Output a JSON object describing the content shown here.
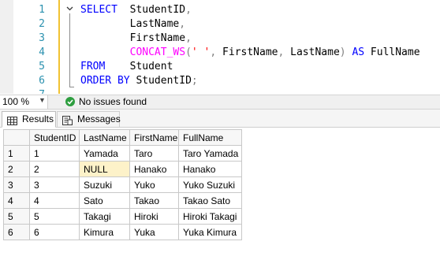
{
  "editor": {
    "lines": [
      {
        "num": "1",
        "tokens": [
          {
            "t": "SELECT",
            "c": "kw"
          },
          {
            "t": "  StudentID",
            "c": "id"
          },
          {
            "t": ",",
            "c": "pun"
          }
        ]
      },
      {
        "num": "2",
        "tokens": [
          {
            "t": "        LastName",
            "c": "id"
          },
          {
            "t": ",",
            "c": "pun"
          }
        ]
      },
      {
        "num": "3",
        "tokens": [
          {
            "t": "        FirstName",
            "c": "id"
          },
          {
            "t": ",",
            "c": "pun"
          }
        ]
      },
      {
        "num": "4",
        "tokens": [
          {
            "t": "        ",
            "c": "id"
          },
          {
            "t": "CONCAT_WS",
            "c": "fn"
          },
          {
            "t": "(",
            "c": "pun"
          },
          {
            "t": "' '",
            "c": "str"
          },
          {
            "t": ", ",
            "c": "pun"
          },
          {
            "t": "FirstName",
            "c": "id"
          },
          {
            "t": ", ",
            "c": "pun"
          },
          {
            "t": "LastName",
            "c": "id"
          },
          {
            "t": ") ",
            "c": "pun"
          },
          {
            "t": "AS",
            "c": "kw"
          },
          {
            "t": " FullName",
            "c": "id"
          }
        ]
      },
      {
        "num": "5",
        "tokens": [
          {
            "t": "FROM",
            "c": "kw"
          },
          {
            "t": "    Student",
            "c": "id"
          }
        ]
      },
      {
        "num": "6",
        "tokens": [
          {
            "t": "ORDER BY",
            "c": "kw"
          },
          {
            "t": " StudentID",
            "c": "id"
          },
          {
            "t": ";",
            "c": "pun"
          }
        ]
      },
      {
        "num": "7",
        "tokens": []
      }
    ]
  },
  "status": {
    "zoom": "100 %",
    "issues": "No issues found"
  },
  "tabs": {
    "results": "Results",
    "messages": "Messages"
  },
  "grid": {
    "columns": [
      "StudentID",
      "LastName",
      "FirstName",
      "FullName"
    ],
    "rows": [
      {
        "num": "1",
        "cells": [
          "1",
          "Yamada",
          "Taro",
          "Taro Yamada"
        ]
      },
      {
        "num": "2",
        "cells": [
          "2",
          "NULL",
          "Hanako",
          "Hanako"
        ]
      },
      {
        "num": "3",
        "cells": [
          "3",
          "Suzuki",
          "Yuko",
          "Yuko Suzuki"
        ]
      },
      {
        "num": "4",
        "cells": [
          "4",
          "Sato",
          "Takao",
          "Takao Sato"
        ]
      },
      {
        "num": "5",
        "cells": [
          "5",
          "Takagi",
          "Hiroki",
          "Hiroki Takagi"
        ]
      },
      {
        "num": "6",
        "cells": [
          "6",
          "Kimura",
          "Yuka",
          "Yuka Kimura"
        ]
      }
    ]
  },
  "colors": {
    "keyword": "#0000ff",
    "function": "#ff00ff",
    "string": "#ff0000",
    "line_number": "#2b91af",
    "null_highlight": "#fdf2c9",
    "ok_green": "#2e9e3f"
  }
}
